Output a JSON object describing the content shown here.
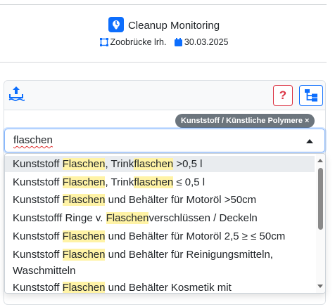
{
  "header": {
    "title": "Cleanup Monitoring",
    "location": "Zoobrücke lrh.",
    "date": "30.03.2025"
  },
  "toolbar": {
    "help_label": "?"
  },
  "category_badge": "Kunststoff / Künstliche Polymere ×",
  "search": {
    "value": "flaschen"
  },
  "options": [
    {
      "parts": [
        "Kunststoff ",
        "Flaschen",
        ", Trink",
        "flaschen",
        " >0,5 l"
      ]
    },
    {
      "parts": [
        "Kunststoff ",
        "Flaschen",
        ", Trink",
        "flaschen",
        " ≤ 0,5 l"
      ]
    },
    {
      "parts": [
        "Kunststoff ",
        "Flaschen",
        " und Behälter für Motoröl >50cm"
      ]
    },
    {
      "parts": [
        "Kunststofff Ringe v. ",
        "Flaschen",
        "verschlüssen / Deckeln"
      ]
    },
    {
      "parts": [
        "Kunststoff ",
        "Flaschen",
        " und Behälter für Motoröl 2,5 ≥ ≤ 50cm"
      ]
    },
    {
      "parts": [
        "Kunststoff ",
        "Flaschen",
        " und Behälter für Reinigungsmitteln,"
      ],
      "line2": "Waschmitteln"
    },
    {
      "parts": [
        "Kunststoff ",
        "Flaschen",
        " und Behälter Kosmetik mit"
      ]
    }
  ],
  "icons": {
    "app": "monitoring-pin-icon",
    "location": "bridge-icon",
    "date": "calendar-icon",
    "upload": "water-upload-icon",
    "tree": "tree-view-icon"
  },
  "colors": {
    "primary": "#0d6efd",
    "danger": "#dc3545",
    "badge": "#6c757d",
    "highlight": "#fff3a6"
  }
}
